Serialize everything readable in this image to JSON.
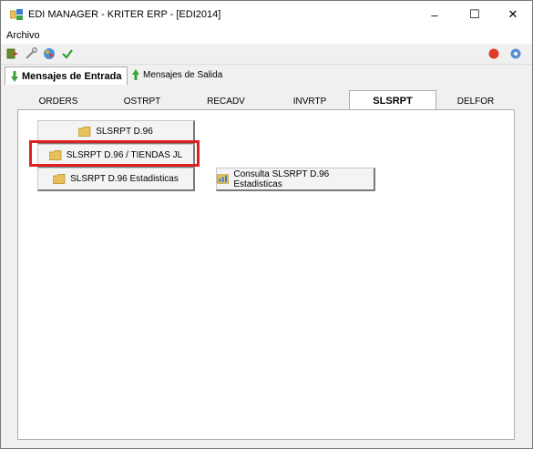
{
  "window": {
    "title": "EDI MANAGER - KRITER ERP - [EDI2014]",
    "controls": {
      "minimize": "–",
      "maximize": "☐",
      "close": "✕"
    }
  },
  "menu": {
    "items": [
      "Archivo"
    ]
  },
  "toolbar": {
    "icons": [
      "export-icon",
      "wrench-icon",
      "palette-icon",
      "checkmark-icon",
      "red-dot-icon",
      "help-icon"
    ]
  },
  "subtabs": [
    {
      "label": "Mensajes de Entrada",
      "active": true,
      "icon": "down-arrow-icon"
    },
    {
      "label": "Mensajes de Salida",
      "active": false,
      "icon": "up-arrow-icon"
    }
  ],
  "tabs": [
    {
      "label": "ORDERS",
      "active": false
    },
    {
      "label": "OSTRPT",
      "active": false
    },
    {
      "label": "RECADV",
      "active": false
    },
    {
      "label": "INVRTP",
      "active": false
    },
    {
      "label": "SLSRPT",
      "active": true
    },
    {
      "label": "DELFOR",
      "active": false
    }
  ],
  "buttons": {
    "slsrpt_d96": "SLSRPT D.96",
    "slsrpt_d96_tiendas": "SLSRPT D.96 / TIENDAS JL",
    "slsrpt_d96_estadisticas": "SLSRPT D.96 Estadisticas",
    "consulta_estadisticas": "Consulta SLSRPT D.96 Estadisticas"
  },
  "colors": {
    "highlight": "#e02020",
    "folder": "#e8c15a",
    "arrow_green": "#3aa43a"
  }
}
